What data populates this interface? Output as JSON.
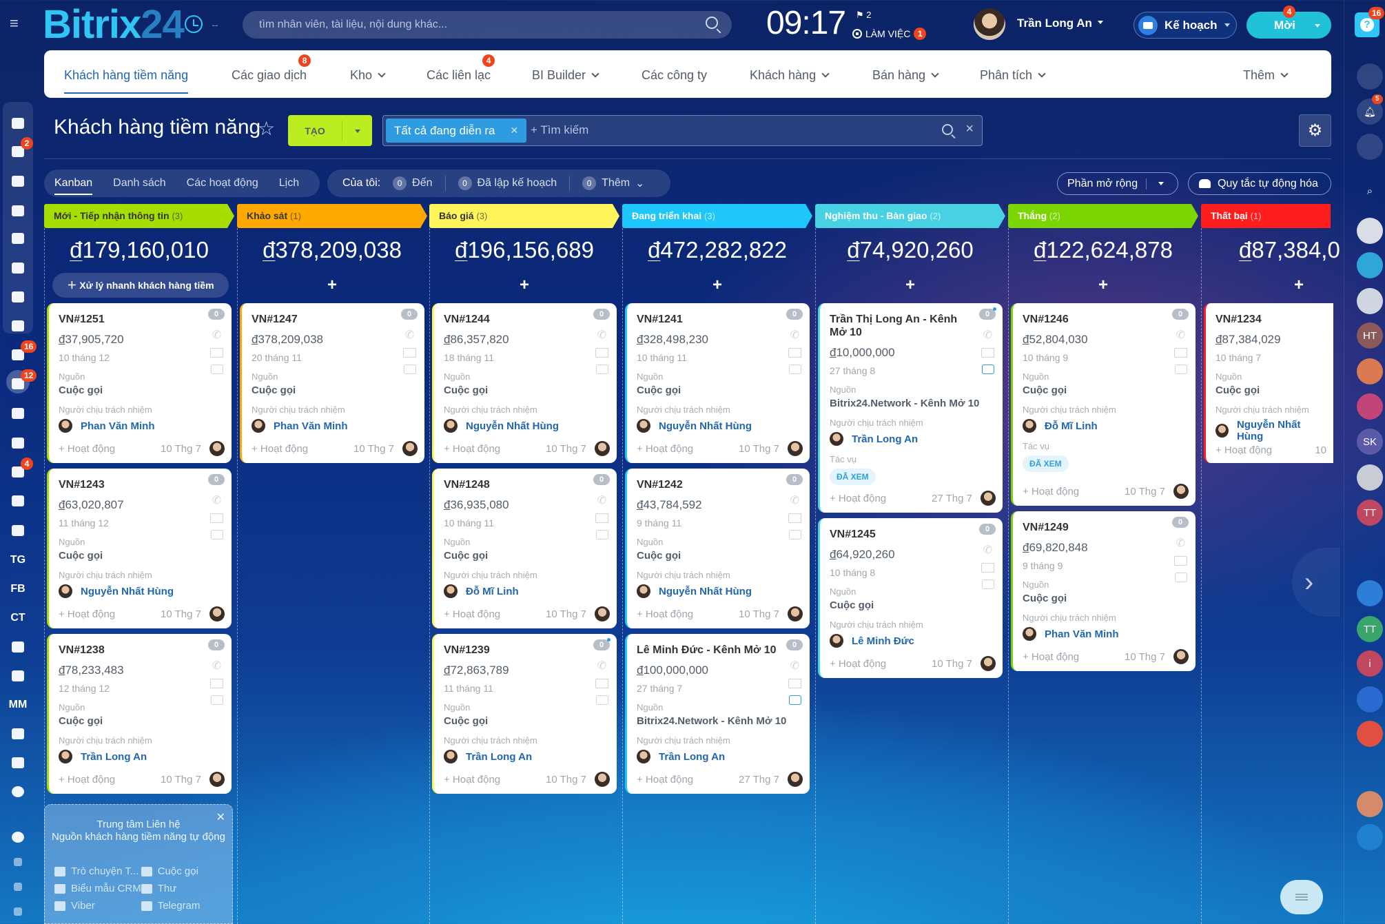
{
  "header": {
    "logo_part1": "Bitrix",
    "logo_part2": "24",
    "search_placeholder": "tìm nhân viên, tài liệu, nội dung khác...",
    "time": "09:17",
    "flag_count": "2",
    "work_status": "LÀM VIỆC",
    "work_badge": "1",
    "user_name": "Trần Long An",
    "plan_label": "Kế hoạch",
    "invite_label": "Mời",
    "invite_badge": "4",
    "help_badge": "16"
  },
  "left_sidebar": {
    "items": [
      {
        "icon": "sitemap-icon",
        "badge": ""
      },
      {
        "icon": "feed-icon",
        "badge": "2"
      },
      {
        "icon": "calendar-icon",
        "badge": ""
      },
      {
        "icon": "document-icon",
        "badge": ""
      },
      {
        "icon": "drive-icon",
        "badge": ""
      },
      {
        "icon": "chat-icon",
        "badge": ""
      },
      {
        "icon": "mail-icon",
        "badge": ""
      },
      {
        "icon": "users-icon",
        "badge": ""
      },
      {
        "icon": "tasks-icon",
        "badge": "16"
      },
      {
        "icon": "crm-funnel-icon",
        "badge": "12"
      },
      {
        "icon": "target-icon",
        "badge": ""
      },
      {
        "icon": "cart-icon",
        "badge": ""
      },
      {
        "icon": "contact-card-icon",
        "badge": "4"
      },
      {
        "icon": "robot-icon",
        "badge": ""
      },
      {
        "icon": "box-icon",
        "badge": ""
      },
      {
        "text": "TG"
      },
      {
        "text": "FB"
      },
      {
        "text": "CT"
      },
      {
        "icon": "warehouse-icon",
        "badge": ""
      },
      {
        "icon": "signature-icon",
        "badge": ""
      },
      {
        "text": "MM"
      },
      {
        "icon": "bar-chart-icon",
        "badge": ""
      },
      {
        "icon": "edit-doc-icon",
        "badge": ""
      },
      {
        "icon": "chevron-down-icon",
        "badge": ""
      },
      {
        "icon": "help-icon",
        "badge": ""
      },
      {
        "icon": "share-icon",
        "badge": ""
      },
      {
        "icon": "settings-icon",
        "badge": ""
      },
      {
        "icon": "plus-icon",
        "badge": ""
      }
    ]
  },
  "nav": {
    "items": [
      {
        "label": "Khách hàng tiềm năng",
        "active": true,
        "dropdown": false,
        "badge": ""
      },
      {
        "label": "Các giao dịch",
        "dropdown": false,
        "badge": "8"
      },
      {
        "label": "Kho",
        "dropdown": true,
        "badge": ""
      },
      {
        "label": "Các liên lạc",
        "dropdown": false,
        "badge": "4"
      },
      {
        "label": "BI Builder",
        "dropdown": true,
        "badge": ""
      },
      {
        "label": "Các công ty",
        "dropdown": false,
        "badge": ""
      },
      {
        "label": "Khách hàng",
        "dropdown": true,
        "badge": ""
      },
      {
        "label": "Bán hàng",
        "dropdown": true,
        "badge": ""
      },
      {
        "label": "Phân tích",
        "dropdown": true,
        "badge": ""
      },
      {
        "label": "Thêm",
        "dropdown": true,
        "badge": ""
      }
    ]
  },
  "page": {
    "title": "Khách hàng tiềm năng",
    "create_label": "TẠO",
    "filter_chip": "Tất cả đang diễn ra",
    "filter_placeholder": "+ Tìm kiếm",
    "view_tabs": [
      "Kanban",
      "Danh sách",
      "Các hoạt động",
      "Lịch"
    ],
    "counters_label": "Của tôi:",
    "counters": [
      {
        "count": "0",
        "label": "Đến"
      },
      {
        "count": "0",
        "label": "Đã lập kế hoạch"
      },
      {
        "count": "0",
        "label": "Thêm"
      }
    ],
    "extensions_label": "Phần mở rộng",
    "automation_label": "Quy tắc tự động hóa",
    "quick_lead_label": "Xử lý nhanh khách hàng tiềm"
  },
  "common": {
    "source_label": "Nguồn",
    "responsible_label": "Người chịu trách nhiệm",
    "task_label": "Tác vụ",
    "activity_label": "+ Hoạt động",
    "currency": "đ"
  },
  "columns": [
    {
      "name": "Mới - Tiếp nhận thông tin",
      "count": "(3)",
      "color": "#a5de00",
      "dark": true,
      "sum": "179,160,010",
      "cards": [
        {
          "title": "VN#1251",
          "amount": "37,905,720",
          "date": "10 tháng 12",
          "source": "Cuộc gọi",
          "responsible": "Phan Văn Minh",
          "activity_date": "10 Thg 7",
          "counter": "0"
        },
        {
          "title": "VN#1243",
          "amount": "63,020,807",
          "date": "11 tháng 12",
          "source": "Cuộc gọi",
          "responsible": "Nguyễn Nhất Hùng",
          "activity_date": "10 Thg 7",
          "counter": "0"
        },
        {
          "title": "VN#1238",
          "amount": "78,233,483",
          "date": "12 tháng 12",
          "source": "Cuộc gọi",
          "responsible": "Trần Long An",
          "activity_date": "10 Thg 7",
          "counter": "0"
        }
      ]
    },
    {
      "name": "Khảo sát",
      "count": "(1)",
      "color": "#ffa900",
      "dark": true,
      "sum": "378,209,038",
      "cards": [
        {
          "title": "VN#1247",
          "amount": "378,209,038",
          "date": "20 tháng 11",
          "source": "Cuộc gọi",
          "responsible": "Phan Văn Minh",
          "activity_date": "10 Thg 7",
          "counter": "0"
        }
      ]
    },
    {
      "name": "Báo giá",
      "count": "(3)",
      "color": "#fff55a",
      "dark": true,
      "sum": "196,156,689",
      "cards": [
        {
          "title": "VN#1244",
          "amount": "86,357,820",
          "date": "18 tháng 11",
          "source": "Cuộc gọi",
          "responsible": "Nguyễn Nhất Hùng",
          "activity_date": "10 Thg 7",
          "counter": "0"
        },
        {
          "title": "VN#1248",
          "amount": "36,935,080",
          "date": "10 tháng 11",
          "source": "Cuộc gọi",
          "responsible": "Đỗ Mĩ Linh",
          "activity_date": "10 Thg 7",
          "counter": "0"
        },
        {
          "title": "VN#1239",
          "amount": "72,863,789",
          "date": "11 tháng 11",
          "source": "Cuộc gọi",
          "responsible": "Trần Long An",
          "activity_date": "10 Thg 7",
          "counter": "0"
        }
      ]
    },
    {
      "name": "Đang triển khai",
      "count": "(3)",
      "color": "#1ec6fa",
      "dark": false,
      "sum": "472,282,822",
      "cards": [
        {
          "title": "VN#1241",
          "amount": "328,498,230",
          "date": "10 tháng 11",
          "source": "Cuộc gọi",
          "responsible": "Nguyễn Nhất Hùng",
          "activity_date": "10 Thg 7",
          "counter": "0"
        },
        {
          "title": "VN#1242",
          "amount": "43,784,592",
          "date": "9 tháng 11",
          "source": "Cuộc gọi",
          "responsible": "Nguyễn Nhất Hùng",
          "activity_date": "10 Thg 7",
          "counter": "0"
        },
        {
          "title": "Lê Minh Đức - Kênh Mở 10",
          "amount": "100,000,000",
          "date": "27 tháng 7",
          "source": "Bitrix24.Network - Kênh Mở 10",
          "responsible": "Trần Long An",
          "activity_date": "27 Thg 7",
          "counter": "0"
        }
      ]
    },
    {
      "name": "Nghiệm thu - Bàn giao",
      "count": "(2)",
      "color": "#47d1e2",
      "dark": false,
      "sum": "74,920,260",
      "cards": [
        {
          "title": "Trần Thị Long An - Kênh Mở 10",
          "amount": "10,000,000",
          "date": "27 tháng 8",
          "source": "Bitrix24.Network - Kênh Mở 10",
          "responsible": "Trần Long An",
          "task": "ĐÃ XEM",
          "activity_date": "27 Thg 7",
          "counter": "0"
        },
        {
          "title": "VN#1245",
          "amount": "64,920,260",
          "date": "10 tháng 8",
          "source": "Cuộc gọi",
          "responsible": "Lê Minh Đức",
          "activity_date": "10 Thg 7",
          "counter": "0"
        }
      ]
    },
    {
      "name": "Thắng",
      "count": "(2)",
      "color": "#7bd500",
      "dark": false,
      "sum": "122,624,878",
      "cards": [
        {
          "title": "VN#1246",
          "amount": "52,804,030",
          "date": "10 tháng 9",
          "source": "Cuộc gọi",
          "responsible": "Đỗ Mĩ Linh",
          "task": "ĐÃ XEM",
          "activity_date": "10 Thg 7",
          "counter": "0"
        },
        {
          "title": "VN#1249",
          "amount": "69,820,848",
          "date": "9 tháng 9",
          "source": "Cuộc gọi",
          "responsible": "Phan Văn Minh",
          "activity_date": "10 Thg 7",
          "counter": "0"
        }
      ]
    },
    {
      "name": "Thất bại",
      "count": "(1)",
      "color": "#ff1e1e",
      "dark": false,
      "sum": "87,384,0",
      "cards": [
        {
          "title": "VN#1234",
          "amount": "87,384,029",
          "date": "10 tháng 7",
          "source": "Cuộc gọi",
          "responsible": "Nguyễn Nhất Hùng",
          "activity_date": "10",
          "counter": ""
        }
      ]
    }
  ],
  "contact_center": {
    "title_line1": "Trung tâm Liên hệ",
    "title_line2": "Nguồn khách hàng tiềm năng tự động",
    "items": [
      "Trò chuyện T...",
      "Cuộc gọi",
      "Biểu mẫu CRM",
      "Thư",
      "Viber",
      "Telegram"
    ]
  },
  "right_sidebar": {
    "notifications_badge": "5",
    "items": [
      "copilot-icon",
      "bell-icon",
      "messages-icon",
      "search-icon",
      "avatar",
      "chat-group",
      "avatar",
      "HT",
      "promo",
      "video",
      "SK",
      "avatar",
      "TT",
      "group",
      "news",
      "TT",
      "info",
      "book-club",
      "idea",
      "food",
      "security",
      "user-time"
    ]
  }
}
